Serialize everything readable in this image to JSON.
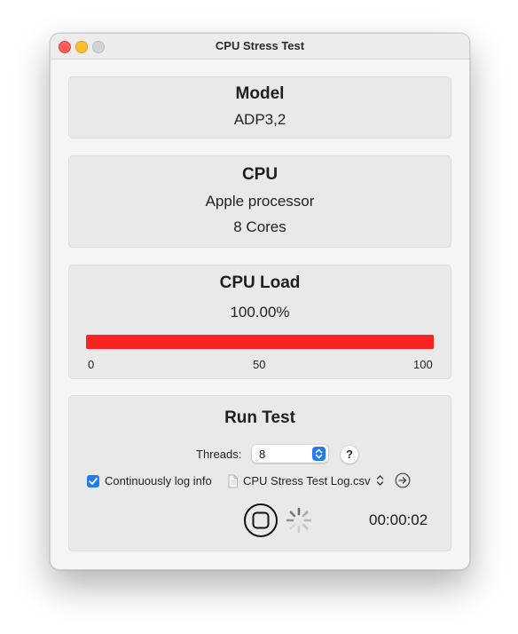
{
  "window": {
    "title": "CPU Stress Test"
  },
  "model": {
    "heading": "Model",
    "value": "ADP3,2"
  },
  "cpu": {
    "heading": "CPU",
    "name": "Apple processor",
    "cores": "8 Cores"
  },
  "load": {
    "heading": "CPU Load",
    "percent_text": "100.00%",
    "level": 1.0,
    "ticks": [
      "0",
      "50",
      "100"
    ],
    "bar_color": "#fa2323"
  },
  "run": {
    "heading": "Run Test",
    "threads_label": "Threads:",
    "threads_value": "8",
    "help_label": "?",
    "log_checked": true,
    "log_label": "Continuously log info",
    "log_file": "CPU Stress Test Log.csv",
    "elapsed": "00:00:02"
  },
  "icons": {
    "stop": "stop-icon",
    "spinner": "activity-spinner-icon",
    "document": "document-icon",
    "reveal": "arrow-circle-right-icon"
  },
  "colors": {
    "accent": "#1f7cf5",
    "close": "#fe5f57",
    "minimize": "#febc2e",
    "zoom": "#d3d3d3"
  }
}
